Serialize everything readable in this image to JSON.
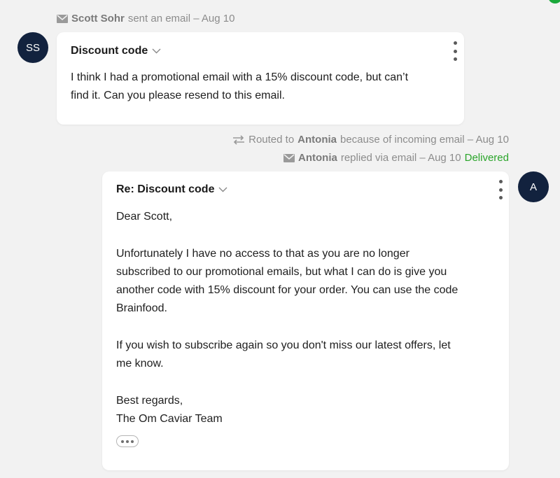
{
  "email1": {
    "meta": {
      "sender": "Scott Sohr",
      "action": "sent an email – Aug 10"
    },
    "avatar_initials": "SS",
    "subject": "Discount code",
    "body_lines": [
      "I think I had a promotional email with a 15% discount code, but can’t",
      "find it.  Can you please resend to this email."
    ]
  },
  "routing": {
    "prefix": "Routed to",
    "agent": "Antonia",
    "suffix": "because of incoming email – Aug 10"
  },
  "reply_meta": {
    "agent": "Antonia",
    "action": "replied via email – Aug 10",
    "status": "Delivered"
  },
  "email2": {
    "avatar_initials": "A",
    "subject": "Re: Discount code",
    "greeting": "Dear Scott,",
    "paragraph1": [
      "Unfortunately I have no access to that as you are no longer",
      "subscribed to our promotional emails, but what I can do is give you",
      "another code with 15% discount for your order. You can use the code",
      "Brainfood."
    ],
    "paragraph2": [
      "If you wish to subscribe again so you don't miss our latest offers, let",
      "me know."
    ],
    "signoff": "Best regards,",
    "signature": "The Om Caviar Team"
  },
  "icons": {
    "mail": "mail-icon",
    "route": "route-icon",
    "chevron": "chevron-down-icon",
    "kebab": "more-vertical-icon",
    "ellipsis": "ellipsis-icon"
  },
  "colors": {
    "background": "#f2f2f2",
    "avatar": "#12223e",
    "delivered": "#2aa52a",
    "meta_text": "#8c8c8c"
  }
}
